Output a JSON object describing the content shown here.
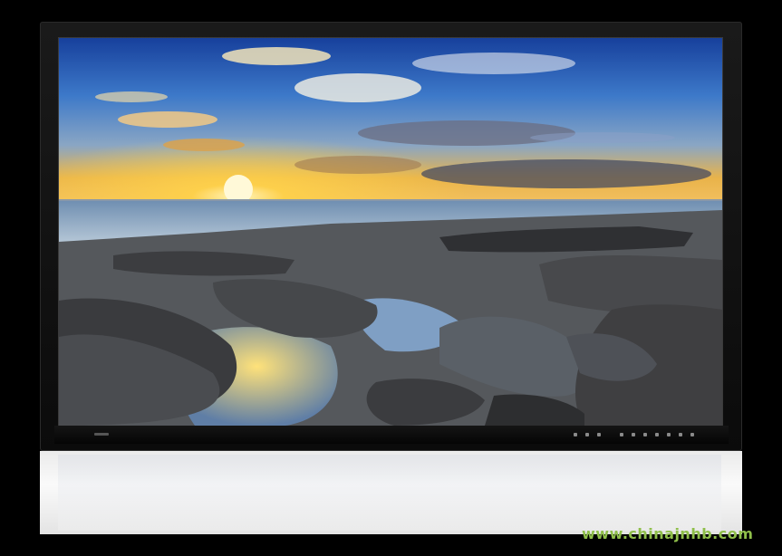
{
  "watermark": {
    "text": "www.chinajnhb.com"
  },
  "colors": {
    "sky_top": "#1c4aa8",
    "sky_mid": "#3d79c9",
    "sun": "#ffd24a",
    "sea": "#7fa4c8",
    "rock": "#4a4b4d",
    "watermark": "#8fbf4a"
  },
  "icons": {
    "power": "power-led-icon",
    "buttons": "panel-button-icon"
  }
}
